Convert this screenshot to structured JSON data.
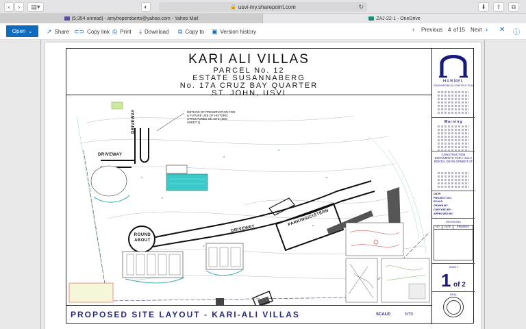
{
  "browser": {
    "url": "usvi-my.sharepoint.com",
    "tabs": [
      {
        "label": "(5,354 unread) - amyhoperoberts@yahoo.com - Yahoo Mail"
      },
      {
        "label": "ZAJ-22-1 - OneDrive"
      }
    ]
  },
  "toolbar": {
    "open_label": "Open",
    "share_label": "Share",
    "copy_link_label": "Copy link",
    "print_label": "Print",
    "download_label": "Download",
    "copy_to_label": "Copy to",
    "version_history_label": "Version history",
    "previous_label": "Previous",
    "page_current": "4",
    "page_of": "of",
    "page_total": "15",
    "next_label": "Next"
  },
  "drawing": {
    "title": "KARI ALI VILLAS",
    "lines": [
      "PARCEL No. 12",
      "ESTATE SUSANNABERG",
      "No. 17A CRUZ BAY QUARTER",
      "ST. JOHN, USVI"
    ],
    "bottom_title": "PROPOSED SITE LAYOUT - KARI-ALI VILLAS",
    "scale_label": "SCALE:",
    "scale_value": "NTS",
    "plan_labels": {
      "driveway_v": "DRIVEWAY",
      "driveway_left": "DRIVEWAY",
      "driveway_main": "DRIVEWAY",
      "roundabout": "ROUND ABOUT",
      "parking": "PARKING/CISTERN",
      "preservation_note": "METHOD OF PRESERVATION FOR & FUTURE USE OF HISTORIC STRUCTURES ON SITE (SEE SHEET 2)"
    }
  },
  "titleblock": {
    "firm": "HARNEL",
    "firm_sub": "ENGINEERING & CONSTRUCTION",
    "warning_label": "Warning",
    "construction_label": "CONSTRUCTION DOCUMENTS FOR A VILLA RENTAL DEVELOPMENT AT",
    "fields": [
      "DATE:",
      "PROJECT NO.:",
      "SCALE:",
      "DRAWN BY:",
      "CHECKED BY:",
      "APPROVED BY:"
    ],
    "revisions_label": "REVISIONS",
    "rev_cols": [
      "NO.",
      "DATE",
      "REMARKS"
    ],
    "sheet_label": "SHEET",
    "sheet_no": "1",
    "sheet_of": "of 2",
    "seal_label": "SEAL"
  },
  "colors": {
    "accent": "#0f6cbd",
    "title_blue": "#1a1a7a",
    "pool": "#3cc9c9"
  }
}
